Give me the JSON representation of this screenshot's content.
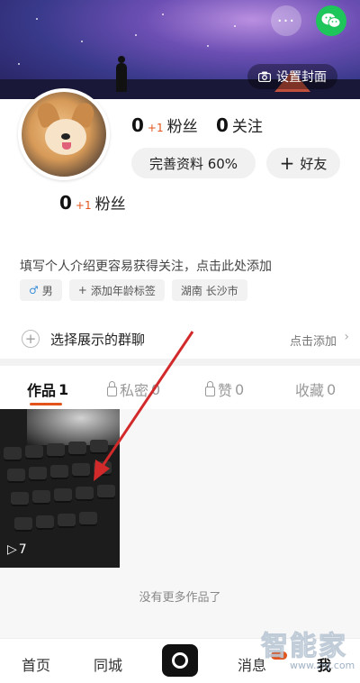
{
  "header": {
    "more_label": "···",
    "set_cover_label": "设置封面"
  },
  "profile": {
    "fans_count": "0",
    "fans_delta": "+1",
    "fans_label": "粉丝",
    "following_count": "0",
    "following_label": "关注",
    "complete_profile_label": "完善资料 60%",
    "add_friend_label": "好友",
    "fans2_count": "0",
    "fans2_delta": "+1",
    "fans2_label": "粉丝"
  },
  "bio": {
    "text": "填写个人介绍更容易获得关注，点击此处添加",
    "tags": [
      {
        "icon": "male-icon",
        "label": "男"
      },
      {
        "icon": "plus-icon",
        "label": "添加年龄标签"
      },
      {
        "icon": "",
        "label": "湖南 长沙市"
      }
    ]
  },
  "group": {
    "label": "选择展示的群聊",
    "action_label": "点击添加"
  },
  "tabs": [
    {
      "label": "作品",
      "count": "1",
      "active": true
    },
    {
      "label": "私密",
      "count": "0",
      "locked": true
    },
    {
      "label": "赞",
      "count": "0",
      "locked": true
    },
    {
      "label": "收藏",
      "count": "0"
    }
  ],
  "works": {
    "play_count": "7",
    "no_more_label": "没有更多作品了"
  },
  "bottom_nav": [
    {
      "label": "首页"
    },
    {
      "label": "同城"
    },
    {
      "label": "消息"
    },
    {
      "label": "我",
      "active": true
    }
  ],
  "watermark": {
    "title": "智能家",
    "url": "www.znj.com"
  },
  "colors": {
    "accent": "#e2541c",
    "wechat": "#1ec55b",
    "arrow": "#d22a2a"
  }
}
